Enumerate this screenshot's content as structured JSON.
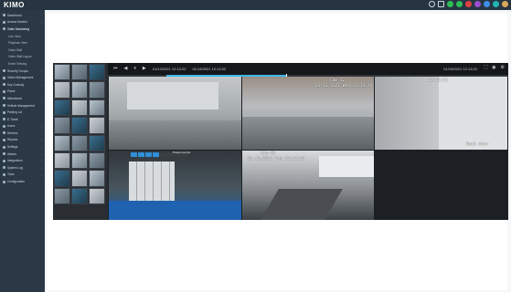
{
  "app": {
    "brand": "KIMO"
  },
  "topbar": {
    "icons": [
      {
        "name": "search-icon",
        "color": "#cfd8e0"
      },
      {
        "name": "grid-icon",
        "color": "#cfd8e0"
      },
      {
        "name": "status-green-icon",
        "color": "#2fbf55"
      },
      {
        "name": "status-green-icon",
        "color": "#2fbf55"
      },
      {
        "name": "status-red-icon",
        "color": "#e04040"
      },
      {
        "name": "status-purple-icon",
        "color": "#9b4fd0"
      },
      {
        "name": "status-blue-icon",
        "color": "#3f8ee8"
      },
      {
        "name": "status-teal-icon",
        "color": "#22b3b3"
      },
      {
        "name": "user-avatar-icon",
        "color": "#d9a65a"
      }
    ]
  },
  "sidebar": {
    "items": [
      {
        "label": "Dashboard",
        "type": "item",
        "chevron": false
      },
      {
        "label": "Access Monitor",
        "type": "item",
        "chevron": true
      },
      {
        "label": "Video Monitoring",
        "type": "item",
        "chevron": false,
        "active": true
      },
      {
        "label": "Live View",
        "type": "sub"
      },
      {
        "label": "Playback View",
        "type": "sub"
      },
      {
        "label": "Video Wall",
        "type": "sub"
      },
      {
        "label": "Video Wall Layout",
        "type": "sub"
      },
      {
        "label": "Event Viewing",
        "type": "sub"
      },
      {
        "label": "Security Groups",
        "type": "item",
        "chevron": true
      },
      {
        "label": "Visitor Management",
        "type": "item",
        "chevron": true
      },
      {
        "label": "Key Custody",
        "type": "item",
        "chevron": true
      },
      {
        "label": "Patrol",
        "type": "item",
        "chevron": false
      },
      {
        "label": "Attendance",
        "type": "item",
        "chevron": true
      },
      {
        "label": "Vehicle Management",
        "type": "item",
        "chevron": false
      },
      {
        "label": "Parking Lot",
        "type": "item",
        "chevron": false
      },
      {
        "label": "E-Ticket",
        "type": "item",
        "chevron": false
      },
      {
        "label": "Users",
        "type": "item",
        "chevron": true
      },
      {
        "label": "Devices",
        "type": "item",
        "chevron": true
      },
      {
        "label": "Reports",
        "type": "item",
        "chevron": true
      },
      {
        "label": "Settings",
        "type": "item",
        "chevron": true
      },
      {
        "label": "Alarms",
        "type": "item",
        "chevron": true
      },
      {
        "label": "Integrations",
        "type": "item",
        "chevron": true
      },
      {
        "label": "System Log",
        "type": "item",
        "chevron": true
      },
      {
        "label": "Tools",
        "type": "item",
        "chevron": true
      },
      {
        "label": "Configuration",
        "type": "item",
        "chevron": false
      }
    ]
  },
  "viewer": {
    "toolbar": {
      "controls": [
        "⏮",
        "◀",
        "⏸",
        "▶"
      ],
      "time_start": "01/13/2021 12:13:22",
      "time_end": "01/13/2021 12:13:22",
      "current_time": "01/13/2021 12:13:22",
      "right_icons": [
        "fullscreen-icon",
        "camera-icon",
        "settings-icon"
      ]
    },
    "timeline": {
      "progress": 0.35
    },
    "thumbnails": 24,
    "cameras": [
      {
        "id": "cam1",
        "osd": ""
      },
      {
        "id": "cam2",
        "osd": ""
      },
      {
        "id": "cam3",
        "osd": "12:13:22"
      },
      {
        "id": "cam4",
        "ptz_label": "Preset Control"
      },
      {
        "id": "cam5",
        "osd_title": "Cam 02",
        "osd": "01-13-2021 Wed 12:13:21"
      },
      {
        "id": "cam6",
        "osd": ""
      }
    ],
    "cam2_osd_title": "Cam 12",
    "cam2_osd": "01-13-2021 Wed 12:13:24",
    "cam3_tag": "Back door"
  }
}
